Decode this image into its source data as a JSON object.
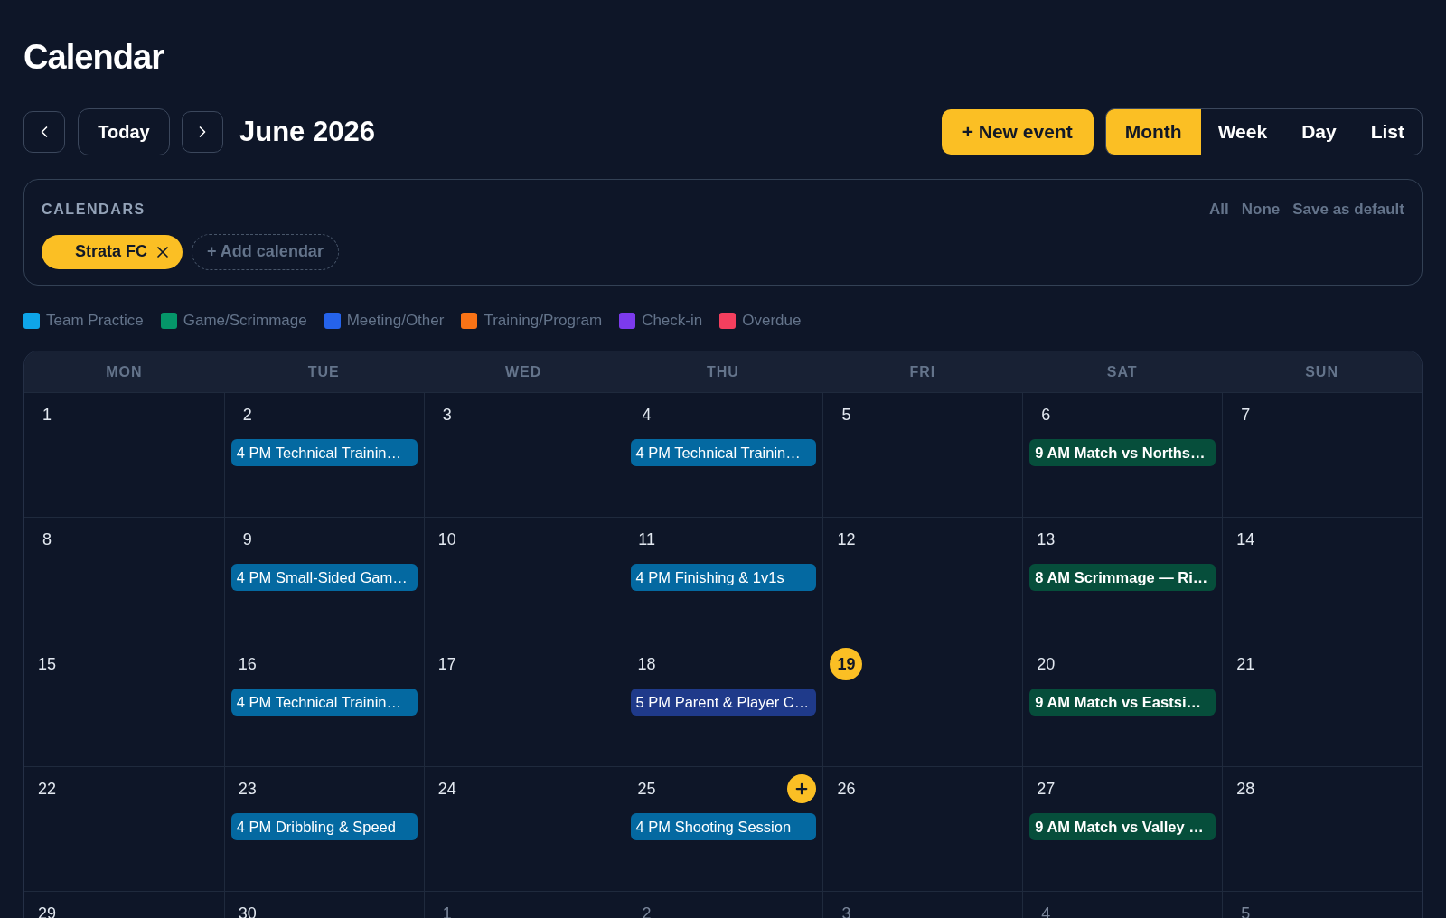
{
  "page": {
    "title": "Calendar"
  },
  "toolbar": {
    "today_button": "Today",
    "period_title": "June 2026",
    "new_event_button": "+ New event",
    "views": [
      {
        "label": "Month",
        "selected": true
      },
      {
        "label": "Week",
        "selected": false
      },
      {
        "label": "Day",
        "selected": false
      },
      {
        "label": "List",
        "selected": false
      }
    ]
  },
  "calendars_panel": {
    "heading": "CALENDARS",
    "actions": [
      "All",
      "None",
      "Save as default"
    ],
    "calendars": [
      {
        "label": "Strata FC"
      }
    ],
    "add_calendar_button": "+ Add calendar"
  },
  "legend": [
    {
      "label": "Team Practice",
      "color": "#0ea5e9"
    },
    {
      "label": "Game/Scrimmage",
      "color": "#059669"
    },
    {
      "label": "Meeting/Other",
      "color": "#2563eb"
    },
    {
      "label": "Training/Program",
      "color": "#f97316"
    },
    {
      "label": "Check-in",
      "color": "#7c3aed"
    },
    {
      "label": "Overdue",
      "color": "#f43f5e"
    }
  ],
  "month_grid": {
    "weekdays": [
      "MON",
      "TUE",
      "WED",
      "THU",
      "FRI",
      "SAT",
      "SUN"
    ],
    "weeks": [
      [
        {
          "day": "1",
          "today": false,
          "outside_month": false,
          "hovered": false
        },
        {
          "day": "2",
          "today": false,
          "outside_month": false,
          "hovered": false,
          "events": [
            {
              "label": "4 PM Technical Trainin…",
              "kind": "practice"
            }
          ]
        },
        {
          "day": "3",
          "today": false,
          "outside_month": false,
          "hovered": false
        },
        {
          "day": "4",
          "today": false,
          "outside_month": false,
          "hovered": false,
          "events": [
            {
              "label": "4 PM Technical Trainin…",
              "kind": "practice"
            }
          ]
        },
        {
          "day": "5",
          "today": false,
          "outside_month": false,
          "hovered": false
        },
        {
          "day": "6",
          "today": false,
          "outside_month": false,
          "hovered": false,
          "events": [
            {
              "label": "9 AM Match vs Norths…",
              "kind": "game"
            }
          ]
        },
        {
          "day": "7",
          "today": false,
          "outside_month": false,
          "hovered": false
        }
      ],
      [
        {
          "day": "8",
          "today": false,
          "outside_month": false,
          "hovered": false
        },
        {
          "day": "9",
          "today": false,
          "outside_month": false,
          "hovered": false,
          "events": [
            {
              "label": "4 PM Small-Sided Gam…",
              "kind": "practice"
            }
          ]
        },
        {
          "day": "10",
          "today": false,
          "outside_month": false,
          "hovered": false
        },
        {
          "day": "11",
          "today": false,
          "outside_month": false,
          "hovered": false,
          "events": [
            {
              "label": "4 PM Finishing & 1v1s",
              "kind": "practice"
            }
          ]
        },
        {
          "day": "12",
          "today": false,
          "outside_month": false,
          "hovered": false
        },
        {
          "day": "13",
          "today": false,
          "outside_month": false,
          "hovered": false,
          "events": [
            {
              "label": "8 AM Scrimmage — Ri…",
              "kind": "game"
            }
          ]
        },
        {
          "day": "14",
          "today": false,
          "outside_month": false,
          "hovered": false
        }
      ],
      [
        {
          "day": "15",
          "today": false,
          "outside_month": false,
          "hovered": false
        },
        {
          "day": "16",
          "today": false,
          "outside_month": false,
          "hovered": false,
          "events": [
            {
              "label": "4 PM Technical Trainin…",
              "kind": "practice"
            }
          ]
        },
        {
          "day": "17",
          "today": false,
          "outside_month": false,
          "hovered": false
        },
        {
          "day": "18",
          "today": false,
          "outside_month": false,
          "hovered": false,
          "events": [
            {
              "label": "5 PM Parent & Player C…",
              "kind": "meeting"
            }
          ]
        },
        {
          "day": "19",
          "today": true,
          "outside_month": false,
          "hovered": false
        },
        {
          "day": "20",
          "today": false,
          "outside_month": false,
          "hovered": false,
          "events": [
            {
              "label": "9 AM Match vs Eastsi…",
              "kind": "game"
            }
          ]
        },
        {
          "day": "21",
          "today": false,
          "outside_month": false,
          "hovered": false
        }
      ],
      [
        {
          "day": "22",
          "today": false,
          "outside_month": false,
          "hovered": false
        },
        {
          "day": "23",
          "today": false,
          "outside_month": false,
          "hovered": false,
          "events": [
            {
              "label": "4 PM Dribbling & Speed",
              "kind": "practice"
            }
          ]
        },
        {
          "day": "24",
          "today": false,
          "outside_month": false,
          "hovered": false
        },
        {
          "day": "25",
          "today": false,
          "outside_month": false,
          "hovered": true,
          "events": [
            {
              "label": "4 PM Shooting Session",
              "kind": "practice"
            }
          ]
        },
        {
          "day": "26",
          "today": false,
          "outside_month": false,
          "hovered": false
        },
        {
          "day": "27",
          "today": false,
          "outside_month": false,
          "hovered": false,
          "events": [
            {
              "label": "9 AM Match vs Valley …",
              "kind": "game"
            }
          ]
        },
        {
          "day": "28",
          "today": false,
          "outside_month": false,
          "hovered": false
        }
      ],
      [
        {
          "day": "29",
          "today": false,
          "outside_month": false,
          "hovered": false
        },
        {
          "day": "30",
          "today": false,
          "outside_month": false,
          "hovered": false
        },
        {
          "day": "1",
          "today": false,
          "outside_month": true,
          "hovered": false
        },
        {
          "day": "2",
          "today": false,
          "outside_month": true,
          "hovered": false
        },
        {
          "day": "3",
          "today": false,
          "outside_month": true,
          "hovered": false
        },
        {
          "day": "4",
          "today": false,
          "outside_month": true,
          "hovered": false
        },
        {
          "day": "5",
          "today": false,
          "outside_month": true,
          "hovered": false
        }
      ]
    ]
  }
}
